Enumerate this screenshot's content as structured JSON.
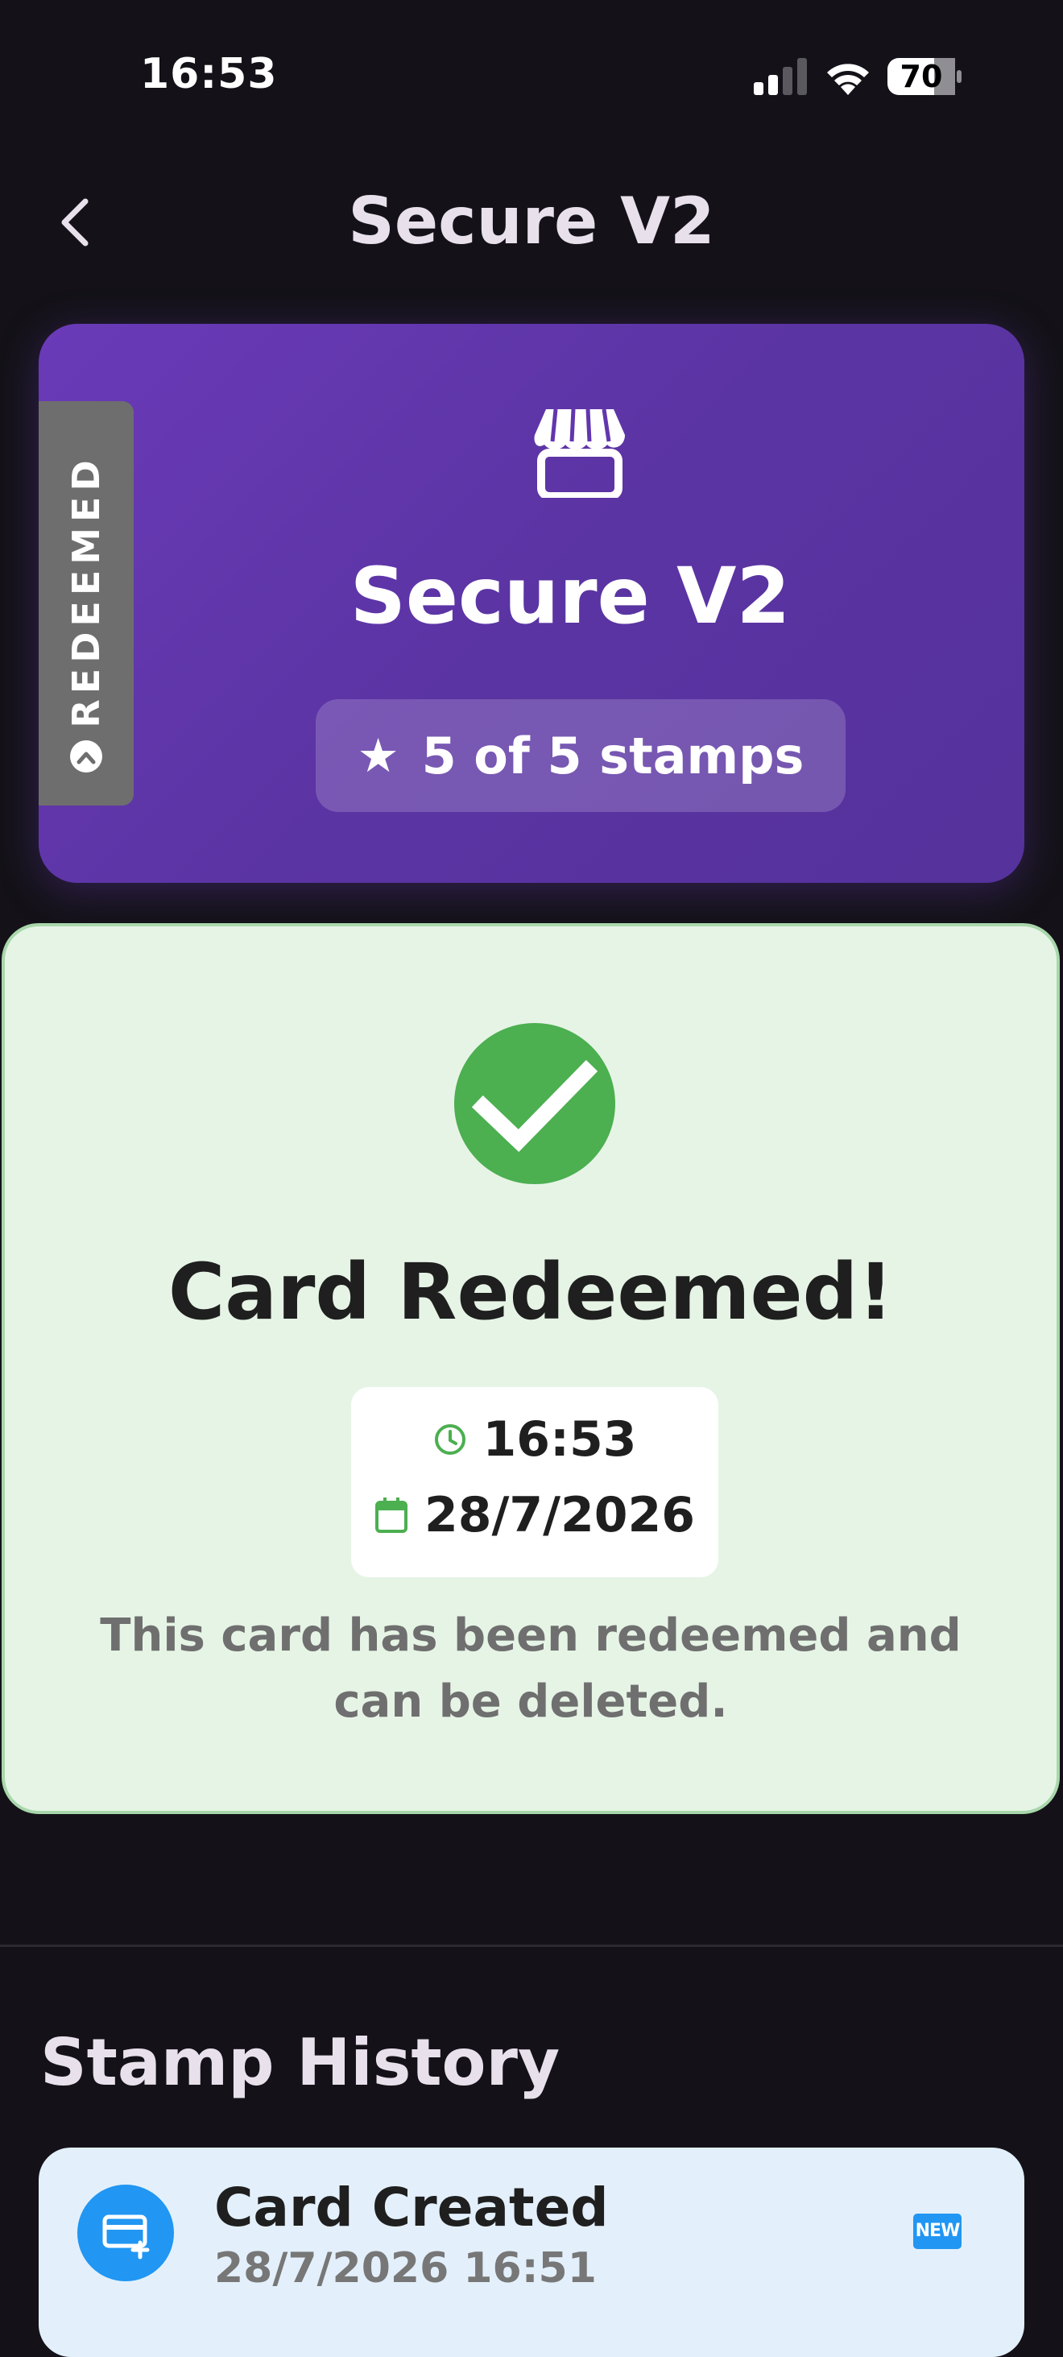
{
  "status_bar": {
    "time": "16:53",
    "battery": "70"
  },
  "nav": {
    "title": "Secure V2"
  },
  "card": {
    "name": "Secure V2",
    "ribbon_label": "REDEEMED",
    "stamps_text": "5 of 5 stamps",
    "stamps_collected": 5,
    "stamps_total": 5,
    "accent_color": "#673AB7"
  },
  "redeemed": {
    "title": "Card Redeemed!",
    "time": "16:53",
    "date": "28/7/2026",
    "description": "This card has been redeemed and can be deleted.",
    "success_color": "#4CAF50"
  },
  "history": {
    "title": "Stamp History",
    "items": [
      {
        "label": "Card Created",
        "date": "28/7/2026 16:51",
        "badge": "NEW",
        "icon": "card-add-icon",
        "icon_color": "#2196F3"
      }
    ]
  }
}
